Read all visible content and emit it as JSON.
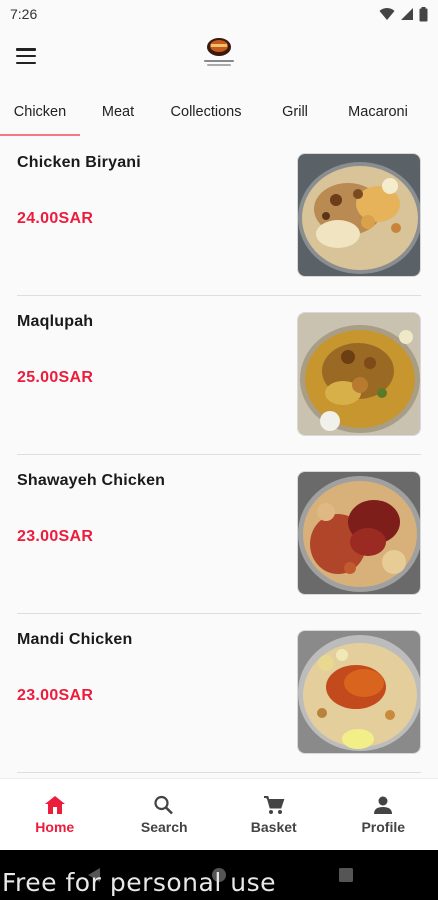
{
  "status": {
    "time": "7:26"
  },
  "tabs": [
    {
      "label": "Chicken"
    },
    {
      "label": "Meat"
    },
    {
      "label": "Collections"
    },
    {
      "label": "Grill"
    },
    {
      "label": "Macaroni"
    }
  ],
  "items": [
    {
      "name": "Chicken Biryani",
      "price": "24.00SAR"
    },
    {
      "name": "Maqlupah",
      "price": "25.00SAR"
    },
    {
      "name": "Shawayeh Chicken",
      "price": "23.00SAR"
    },
    {
      "name": "Mandi Chicken",
      "price": "23.00SAR"
    }
  ],
  "nav": [
    {
      "label": "Home",
      "icon": "home-icon"
    },
    {
      "label": "Search",
      "icon": "search-icon"
    },
    {
      "label": "Basket",
      "icon": "cart-icon"
    },
    {
      "label": "Profile",
      "icon": "person-icon"
    }
  ],
  "watermark": "Free for personal use",
  "colors": {
    "accent": "#ec1c3d",
    "tab_indicator": "#f27a86"
  }
}
